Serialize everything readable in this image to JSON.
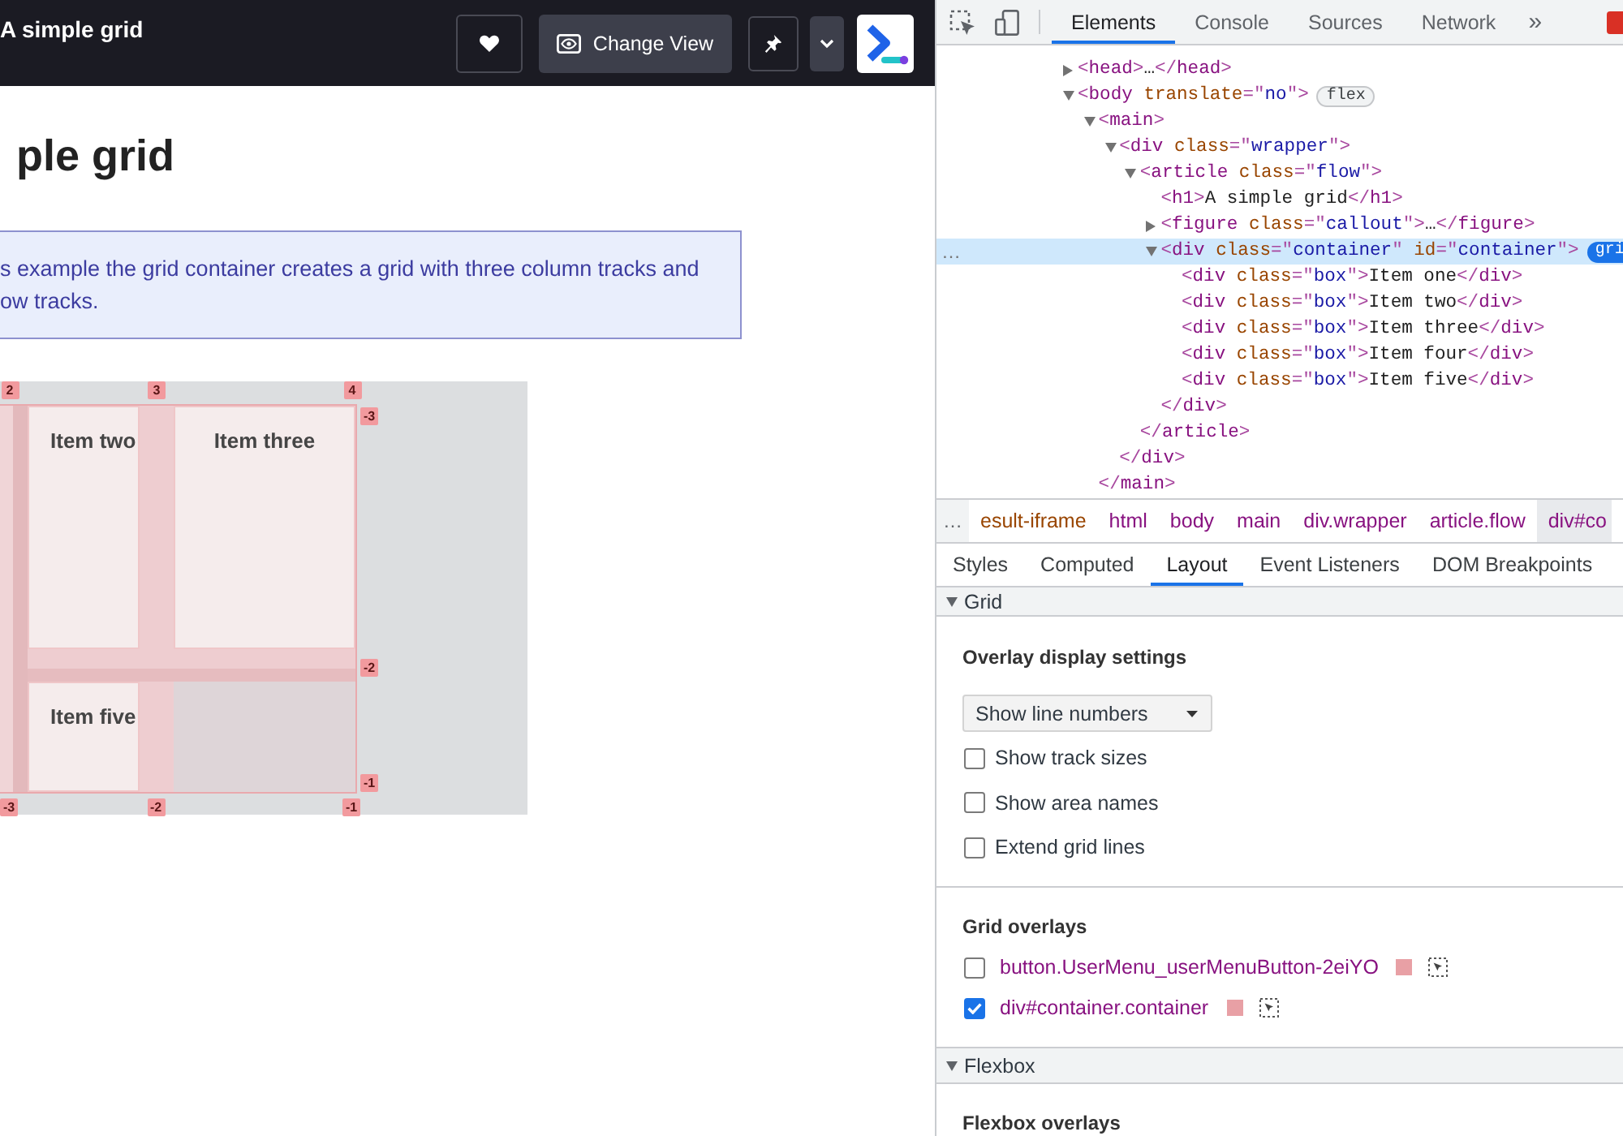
{
  "app_bar": {
    "title": "A simple grid",
    "change_view_label": "Change View"
  },
  "page": {
    "heading": "ple grid",
    "callout_lines": [
      "s example the grid container creates a grid with three column tracks and",
      "ow tracks."
    ],
    "grid": {
      "items": [
        {
          "label": "Item two"
        },
        {
          "label": "Item three"
        },
        {
          "label": "Item five"
        }
      ],
      "top_line_labels": [
        "2",
        "3",
        "4"
      ],
      "right_line_labels": [
        "-3",
        "-2",
        "-1"
      ],
      "bottom_line_labels": [
        "-3",
        "-2",
        "-1"
      ]
    }
  },
  "devtools": {
    "tabs": [
      {
        "label": "Elements",
        "selected": true
      },
      {
        "label": "Console",
        "selected": false
      },
      {
        "label": "Sources",
        "selected": false
      },
      {
        "label": "Network",
        "selected": false
      }
    ],
    "more_tabs": "»",
    "dom_tree": [
      {
        "kind": "parent",
        "markup": "<head>…</head>",
        "expanded": false,
        "selected": false
      },
      {
        "kind": "parent",
        "markup": "<body translate=\"no\">",
        "badge": {
          "label": "flex",
          "active": false
        },
        "expanded": true,
        "selected": false,
        "children": [
          {
            "kind": "parent",
            "markup": "<main>",
            "expanded": true,
            "selected": false,
            "closing": "</main>",
            "children": [
              {
                "kind": "parent",
                "markup": "<div class=\"wrapper\">",
                "expanded": true,
                "selected": false,
                "closing": "</div>",
                "children": [
                  {
                    "kind": "parent",
                    "markup": "<article class=\"flow\">",
                    "expanded": true,
                    "selected": false,
                    "closing": "</article>",
                    "children": [
                      {
                        "kind": "leaf",
                        "markup": "<h1>A simple grid</h1>",
                        "selected": false
                      },
                      {
                        "kind": "parent",
                        "markup": "<figure class=\"callout\">…</figure>",
                        "expanded": false,
                        "selected": false
                      },
                      {
                        "kind": "parent",
                        "markup": "<div class=\"container\" id=\"container\">",
                        "menu": "…",
                        "badge": {
                          "label": "gri",
                          "active": true
                        },
                        "expanded": true,
                        "selected": true,
                        "closing": "</div>",
                        "children": [
                          {
                            "kind": "leaf",
                            "markup": "<div class=\"box\">Item one</div>",
                            "selected": false
                          },
                          {
                            "kind": "leaf",
                            "markup": "<div class=\"box\">Item two</div>",
                            "selected": false
                          },
                          {
                            "kind": "leaf",
                            "markup": "<div class=\"box\">Item three</div>",
                            "selected": false
                          },
                          {
                            "kind": "leaf",
                            "markup": "<div class=\"box\">Item four</div>",
                            "selected": false
                          },
                          {
                            "kind": "leaf",
                            "markup": "<div class=\"box\">Item five</div>",
                            "selected": false
                          }
                        ]
                      }
                    ]
                  }
                ]
              }
            ]
          }
        ]
      }
    ],
    "breadcrumbs": {
      "more": "…",
      "items": [
        {
          "label": "esult-iframe",
          "kind": "id",
          "selected": false
        },
        {
          "label": "html",
          "kind": "node",
          "selected": false
        },
        {
          "label": "body",
          "kind": "node",
          "selected": false
        },
        {
          "label": "main",
          "kind": "node",
          "selected": false
        },
        {
          "label": "div.wrapper",
          "kind": "node",
          "selected": false
        },
        {
          "label": "article.flow",
          "kind": "node",
          "selected": false
        },
        {
          "label": "div#co",
          "kind": "node",
          "selected": true
        }
      ]
    },
    "panel_tabs": [
      {
        "label": "Styles",
        "selected": false
      },
      {
        "label": "Computed",
        "selected": false
      },
      {
        "label": "Layout",
        "selected": true
      },
      {
        "label": "Event Listeners",
        "selected": false
      },
      {
        "label": "DOM Breakpoints",
        "selected": false
      }
    ],
    "sections": [
      {
        "kind": "grid",
        "title": "Grid",
        "expanded": true,
        "settings_heading": "Overlay display settings",
        "display_mode": "Show line numbers",
        "options": [
          {
            "label": "Show track sizes",
            "checked": false
          },
          {
            "label": "Show area names",
            "checked": false
          },
          {
            "label": "Extend grid lines",
            "checked": false
          }
        ],
        "overlays_heading": "Grid overlays",
        "overlays": [
          {
            "label": "button.UserMenu_userMenuButton-2eiYO",
            "checked": false,
            "color": "#e8a0a5"
          },
          {
            "label": "div#container.container",
            "checked": true,
            "color": "#e8a0a5"
          }
        ]
      },
      {
        "kind": "flexbox",
        "title": "Flexbox",
        "expanded": true,
        "overlays_heading": "Flexbox overlays"
      }
    ]
  }
}
